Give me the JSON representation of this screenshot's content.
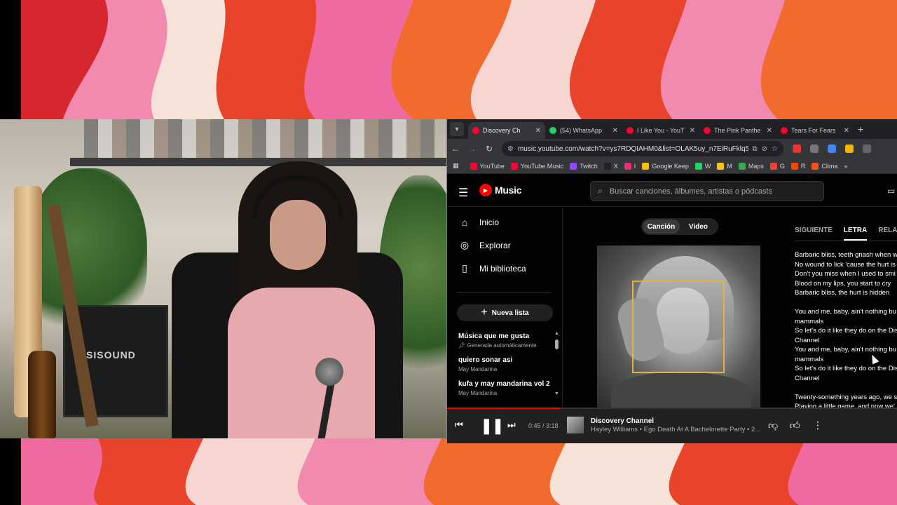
{
  "browser": {
    "tabs": [
      {
        "label": "Discovery Ch",
        "color": "#ff0033",
        "active": true
      },
      {
        "label": "(54) WhatsApp",
        "color": "#25d366",
        "active": false
      },
      {
        "label": "I Like You - YouT",
        "color": "#ff0033",
        "active": false
      },
      {
        "label": "The Pink Panthe",
        "color": "#ff0033",
        "active": false
      },
      {
        "label": "Tears For Fears",
        "color": "#ff0033",
        "active": false
      }
    ],
    "url": "music.youtube.com/watch?v=ys7RDQIAHM0&list=OLAK5uy_n7EiRuFklq5j...",
    "bookmarks": [
      {
        "label": "YouTube",
        "color": "#ff0033"
      },
      {
        "label": "YouTube Music",
        "color": "#ff0033"
      },
      {
        "label": "Twitch",
        "color": "#9146ff"
      },
      {
        "label": "X",
        "color": "#222222"
      },
      {
        "label": "I",
        "color": "#e1306c"
      },
      {
        "label": "Google Keep",
        "color": "#fbbc04"
      },
      {
        "label": "W",
        "color": "#25d366"
      },
      {
        "label": "M",
        "color": "#f5c518"
      },
      {
        "label": "Maps",
        "color": "#34a853"
      },
      {
        "label": "G",
        "color": "#ea4335"
      },
      {
        "label": "R",
        "color": "#ff4500"
      },
      {
        "label": "Clima",
        "color": "#f4511e"
      }
    ]
  },
  "ytmusic": {
    "logo": "Music",
    "search_placeholder": "Buscar canciones, álbumes, artistas o pódcasts",
    "nav": [
      {
        "label": "Inicio",
        "icon": "home-icon"
      },
      {
        "label": "Explorar",
        "icon": "explore-icon"
      },
      {
        "label": "Mi biblioteca",
        "icon": "library-icon"
      }
    ],
    "new_list": "Nueva lista",
    "playlists": [
      {
        "title": "Música que me gusta",
        "subtitle": "Generada automáticamente"
      },
      {
        "title": "quiero sonar asi",
        "subtitle": "May Mandarina"
      },
      {
        "title": "kufa y may mandarina vol 2",
        "subtitle": "May Mandarina"
      }
    ],
    "toggle": {
      "song": "Canción",
      "video": "Video"
    },
    "lyric_tabs": [
      "SIGUIENTE",
      "LETRA",
      "RELA"
    ],
    "lyrics": [
      "Barbaric bliss, teeth gnash when w",
      "No wound to lick 'cause the hurt is",
      "Don't you miss when I used to smi",
      "Blood on my lips, you start to cry",
      "Barbaric bliss, the hurt is hidden",
      "",
      "You and me, baby, ain't nothing bu",
      "mammals",
      "So let's do it like they do on the Dis",
      "Channel",
      "You and me, baby, ain't nothing bu",
      "mammals",
      "So let's do it like they do on the Dis",
      "Channel",
      "",
      "Twenty-something years ago, we s",
      "Playing a little game, and now we'"
    ]
  },
  "player": {
    "time": "0:45 / 3:18",
    "progress": 0.25,
    "song_title": "Discovery Channel",
    "song_subtitle": "Hayley Williams • Ego Death At A Bachelorette Party • 2..."
  },
  "webcam": {
    "amp_label": "SISOUND"
  }
}
